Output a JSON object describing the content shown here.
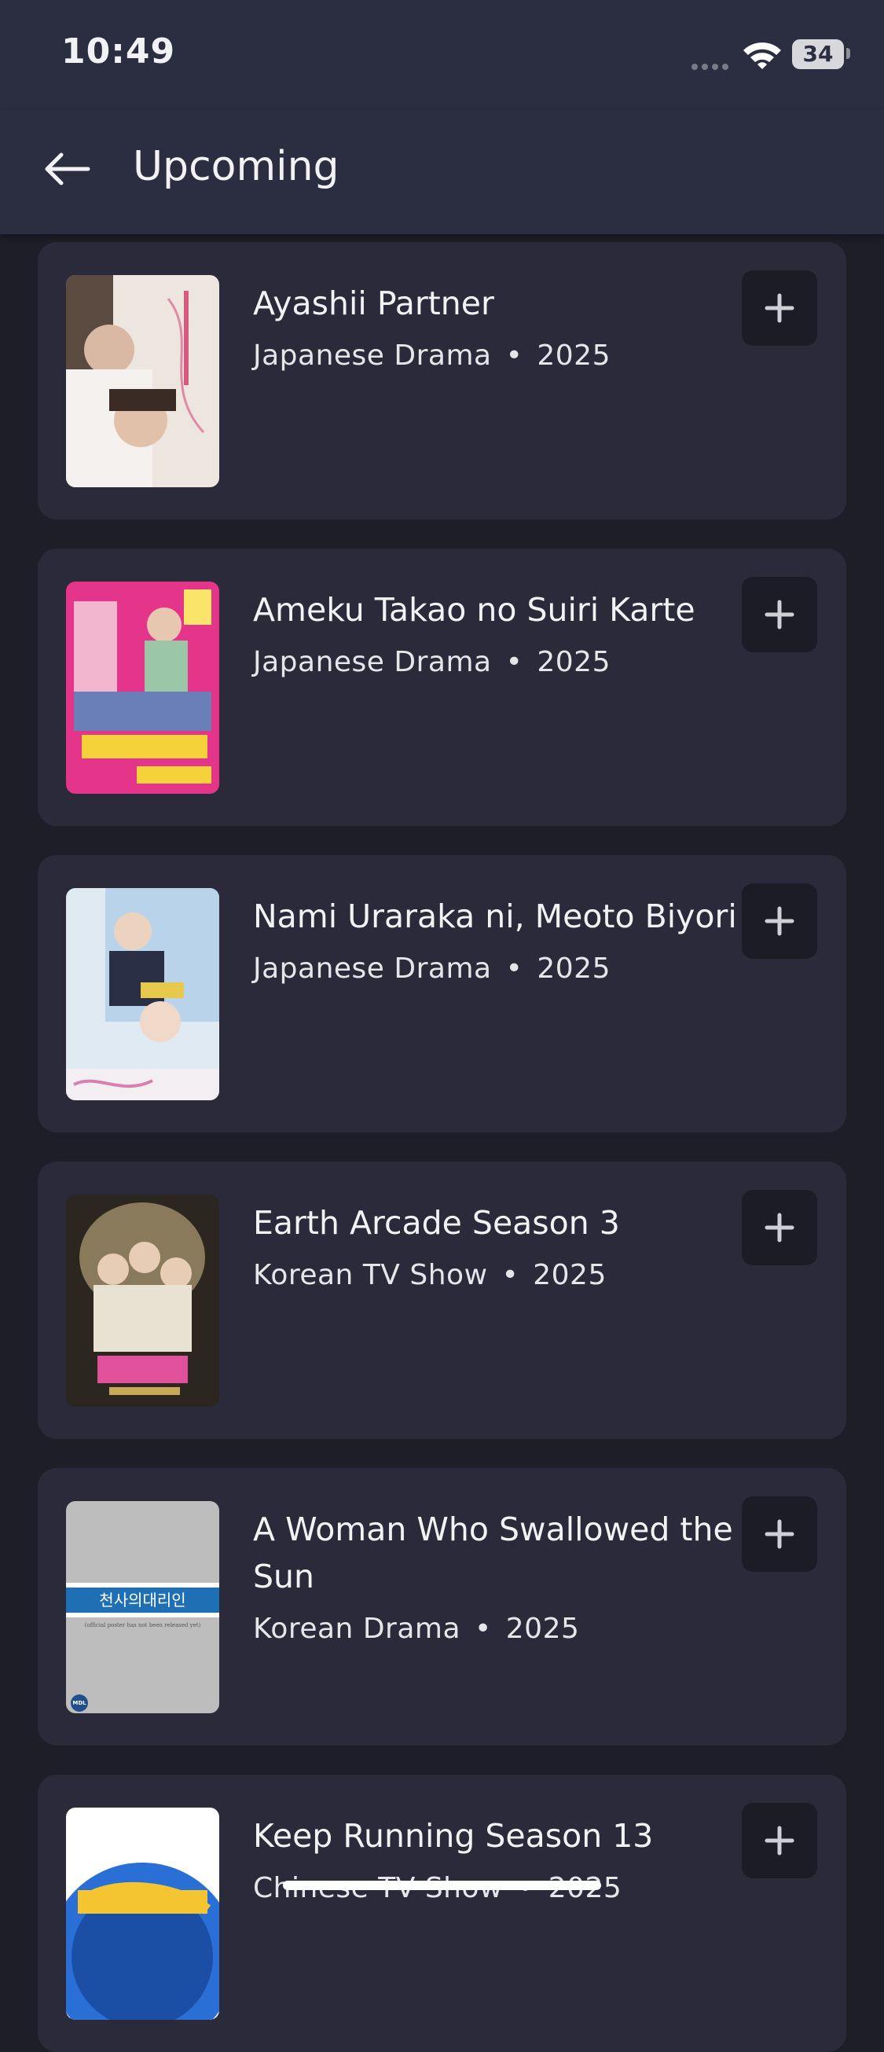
{
  "status": {
    "time": "10:49",
    "battery": "34"
  },
  "header": {
    "title": "Upcoming"
  },
  "items": [
    {
      "title": "Ayashii Partner",
      "type": "Japanese Drama",
      "year": "2025"
    },
    {
      "title": "Ameku Takao no Suiri Karte",
      "type": "Japanese Drama",
      "year": "2025"
    },
    {
      "title": "Nami Uraraka ni, Meoto Biyori",
      "type": "Japanese Drama",
      "year": "2025"
    },
    {
      "title": "Earth Arcade Season 3",
      "type": "Korean TV Show",
      "year": "2025"
    },
    {
      "title": "A Woman Who Swallowed the Sun",
      "type": "Korean Drama",
      "year": "2025",
      "poster_text": "천사의대리인",
      "poster_note": "(official poster has not been released yet)",
      "poster_badge": "MDL"
    },
    {
      "title": "Keep Running Season 13",
      "type": "Chinese TV Show",
      "year": "2025"
    }
  ],
  "colors": {
    "background": "#1e1e29",
    "bar": "#2b2d40",
    "card": "#2a2a3a",
    "button": "#1c1c26"
  }
}
